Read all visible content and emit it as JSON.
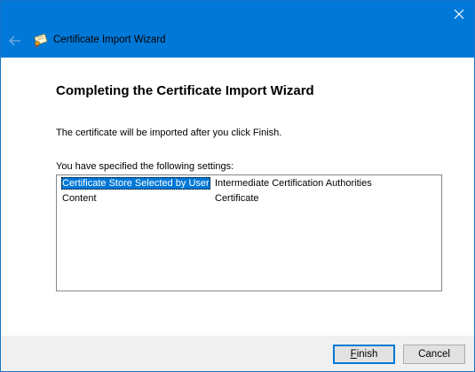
{
  "window": {
    "title": "Certificate Import Wizard",
    "close_icon": "close-icon",
    "back_icon": "back-arrow-icon",
    "app_icon": "certificate-icon",
    "accent_color": "#0078d7"
  },
  "main": {
    "heading": "Completing the Certificate Import Wizard",
    "info_text": "The certificate will be imported after you click Finish.",
    "settings_label": "You have specified the following settings:",
    "settings": [
      {
        "key": "Certificate Store Selected by User",
        "value": "Intermediate Certification Authorities",
        "selected": true
      },
      {
        "key": "Content",
        "value": "Certificate",
        "selected": false
      }
    ]
  },
  "footer": {
    "finish_label": "Finish",
    "finish_access_key": "F",
    "cancel_label": "Cancel"
  }
}
